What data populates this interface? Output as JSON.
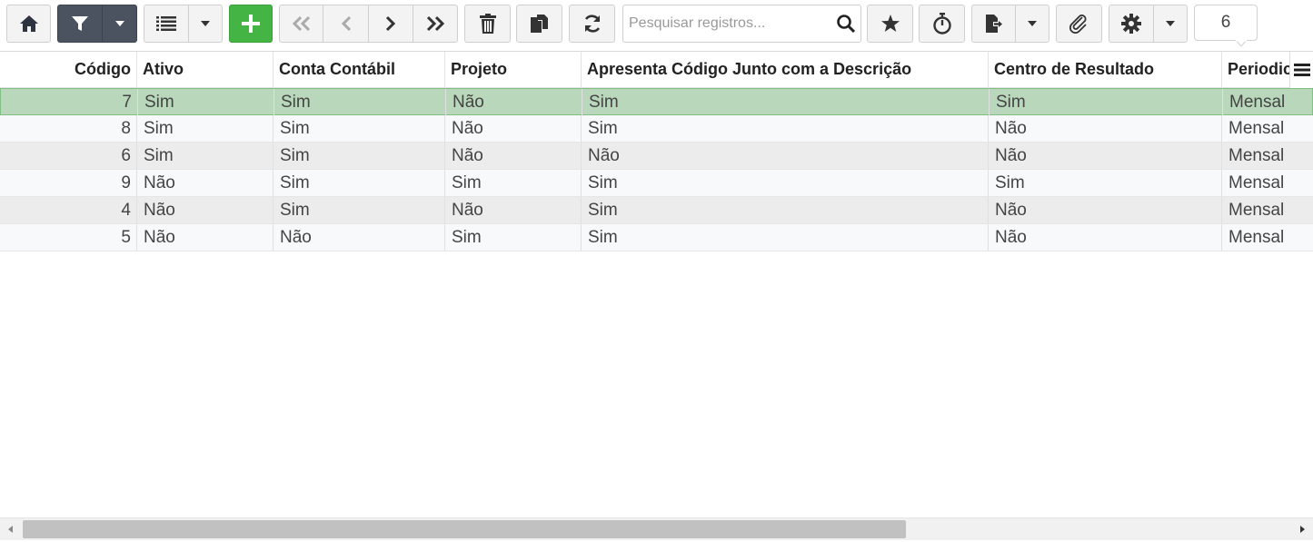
{
  "toolbar": {
    "search_placeholder": "Pesquisar registros...",
    "record_count": "6",
    "icons": {
      "home": "home-icon",
      "filter": "filter-icon",
      "list": "list-icon",
      "add": "plus-icon",
      "first": "double-chevron-left-icon",
      "prev": "chevron-left-icon",
      "next": "chevron-right-icon",
      "last": "double-chevron-right-icon",
      "delete": "trash-icon",
      "copy": "copy-icon",
      "refresh": "refresh-icon",
      "search": "search-icon",
      "favorite": "star-icon",
      "timer": "stopwatch-icon",
      "export": "export-icon",
      "attach": "paperclip-icon",
      "settings": "gear-icon",
      "dropdown": "caret-down-icon"
    },
    "colors": {
      "filter_active": "#4b5361",
      "add": "#44b544"
    }
  },
  "grid": {
    "columns": [
      "Código",
      "Ativo",
      "Conta Contábil",
      "Projeto",
      "Apresenta Código Junto com a Descrição",
      "Centro de Resultado",
      "Periodicidade"
    ],
    "rows": [
      [
        "7",
        "Sim",
        "Sim",
        "Não",
        "Sim",
        "Sim",
        "Mensal"
      ],
      [
        "8",
        "Sim",
        "Sim",
        "Não",
        "Sim",
        "Não",
        "Mensal"
      ],
      [
        "6",
        "Sim",
        "Sim",
        "Não",
        "Não",
        "Não",
        "Mensal"
      ],
      [
        "9",
        "Não",
        "Sim",
        "Sim",
        "Sim",
        "Sim",
        "Mensal"
      ],
      [
        "4",
        "Não",
        "Sim",
        "Não",
        "Sim",
        "Não",
        "Mensal"
      ],
      [
        "5",
        "Não",
        "Não",
        "Sim",
        "Sim",
        "Não",
        "Mensal"
      ]
    ],
    "selected_row": 0,
    "colors": {
      "selected": "#b9d7bb"
    }
  }
}
